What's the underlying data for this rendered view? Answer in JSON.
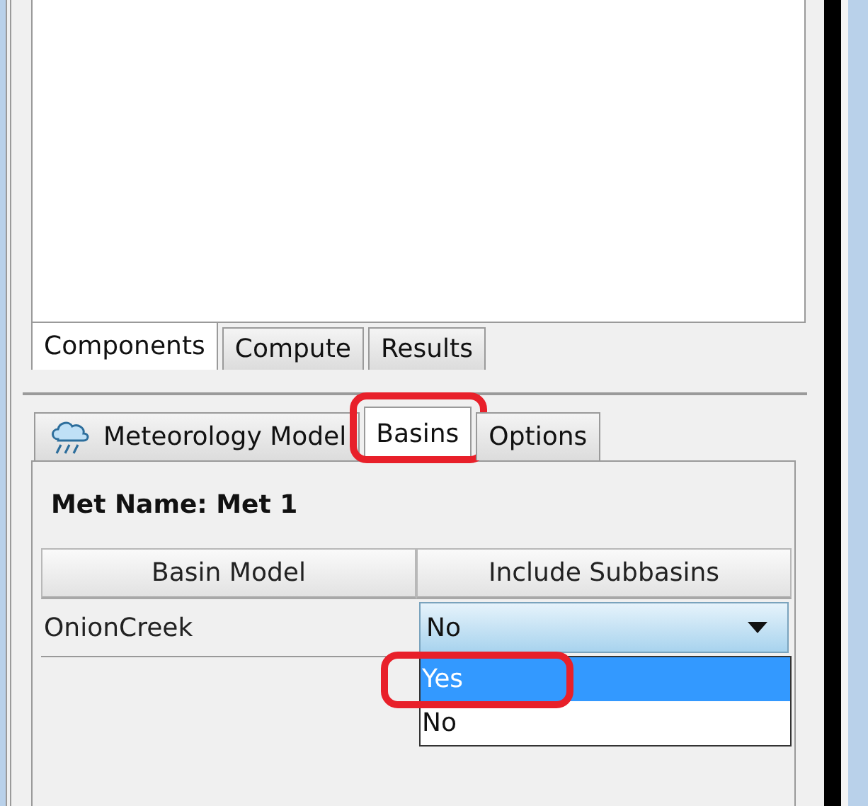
{
  "top_tabs": [
    {
      "label": "Components",
      "selected": true
    },
    {
      "label": "Compute",
      "selected": false
    },
    {
      "label": "Results",
      "selected": false
    }
  ],
  "editor_tabs": [
    {
      "label": "Meteorology Model",
      "selected": false,
      "highlighted": false
    },
    {
      "label": "Basins",
      "selected": true,
      "highlighted": true
    },
    {
      "label": "Options",
      "selected": false,
      "highlighted": false
    }
  ],
  "met_name": "Met Name: Met 1",
  "table": {
    "columns": [
      "Basin Model",
      "Include Subbasins"
    ],
    "rows": [
      {
        "basin_model": "OnionCreek",
        "include_subbasins": "No",
        "expanded": true
      }
    ]
  },
  "dropdown_options": [
    {
      "label": "Yes",
      "selected": true,
      "highlighted": true
    },
    {
      "label": "No",
      "selected": false,
      "highlighted": false
    }
  ]
}
